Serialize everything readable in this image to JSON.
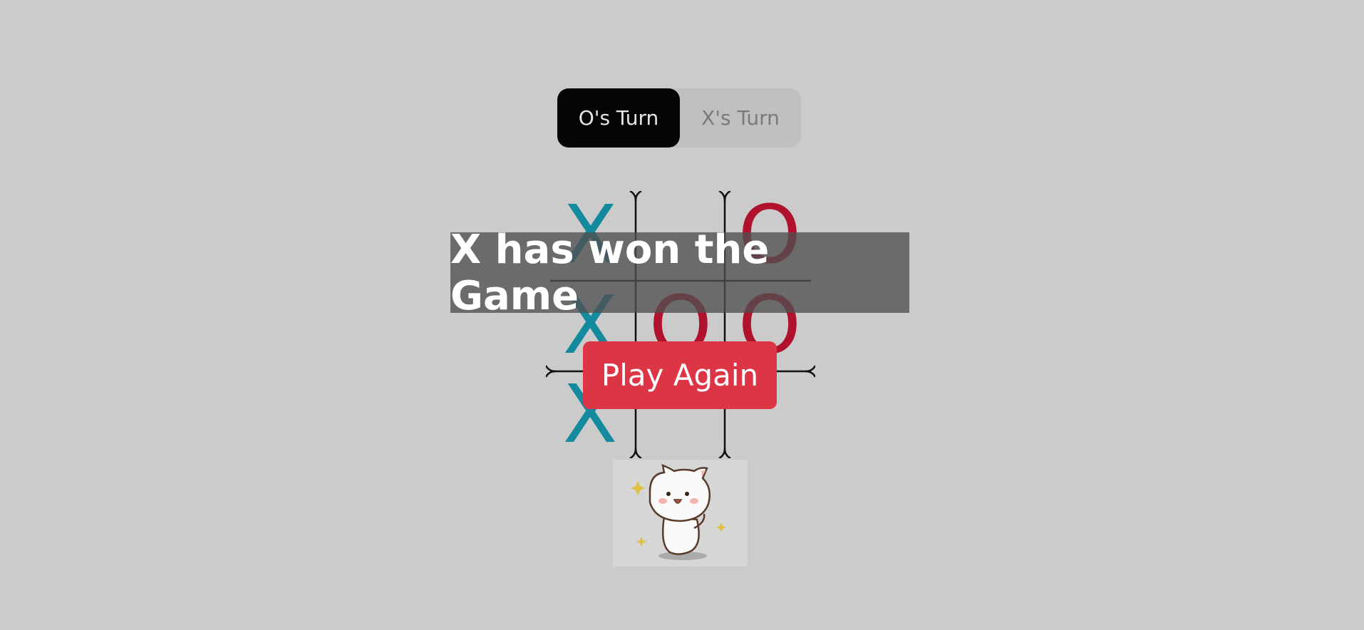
{
  "turn_toggle": {
    "o_label": "O's Turn",
    "x_label": "X's Turn",
    "active": "O"
  },
  "board": {
    "cells": [
      "X",
      "",
      "O",
      "X",
      "O",
      "O",
      "X",
      "",
      ""
    ]
  },
  "result": {
    "message": "X has won the Game",
    "play_again_label": "Play Again"
  },
  "colors": {
    "x": "#138a9e",
    "o": "#b0122e",
    "play_again": "#dc3545"
  },
  "image": {
    "icon": "cat-celebrating-sticker"
  }
}
